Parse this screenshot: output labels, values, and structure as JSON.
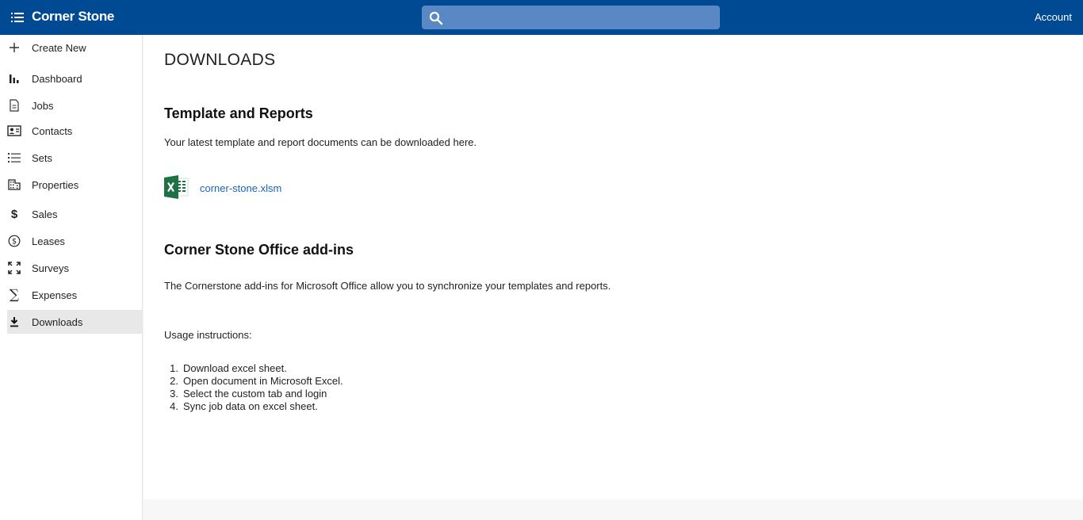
{
  "header": {
    "app_title": "Corner Stone",
    "search_placeholder": "",
    "account_label": "Account"
  },
  "sidebar": {
    "items": [
      {
        "label": "Create New",
        "icon": "plus-icon"
      },
      {
        "label": "Dashboard",
        "icon": "bar-chart-icon"
      },
      {
        "label": "Jobs",
        "icon": "document-icon"
      },
      {
        "label": "Contacts",
        "icon": "contact-card-icon"
      },
      {
        "label": "Sets",
        "icon": "list-icon"
      },
      {
        "label": "Properties",
        "icon": "building-icon"
      },
      {
        "label": "Sales",
        "icon": "dollar-icon"
      },
      {
        "label": "Leases",
        "icon": "dollar-circle-icon"
      },
      {
        "label": "Surveys",
        "icon": "expand-icon"
      },
      {
        "label": "Expenses",
        "icon": "sigma-icon"
      },
      {
        "label": "Downloads",
        "icon": "download-icon",
        "active": true
      }
    ]
  },
  "main": {
    "page_title": "DOWNLOADS",
    "templates": {
      "heading": "Template and Reports",
      "description": "Your latest template and report documents can be downloaded here.",
      "file_name": "corner-stone.xlsm",
      "file_icon": "excel-icon"
    },
    "addins": {
      "heading": "Corner Stone Office add-ins",
      "description": "The Cornerstone add-ins for Microsoft Office allow you to synchronize your templates and reports.",
      "usage_label": "Usage instructions:",
      "steps": [
        {
          "num": "1.",
          "text": "Download excel sheet."
        },
        {
          "num": "2.",
          "text": "Open document in Microsoft Excel."
        },
        {
          "num": "3.",
          "text": "Select the custom tab and login"
        },
        {
          "num": "4.",
          "text": "Sync job data on excel sheet."
        }
      ]
    }
  },
  "colors": {
    "topbar": "#004a94",
    "search_bg": "#5a88c4",
    "link": "#1565c0",
    "active_nav": "#e8e8e8",
    "excel_green": "#1e7145"
  }
}
